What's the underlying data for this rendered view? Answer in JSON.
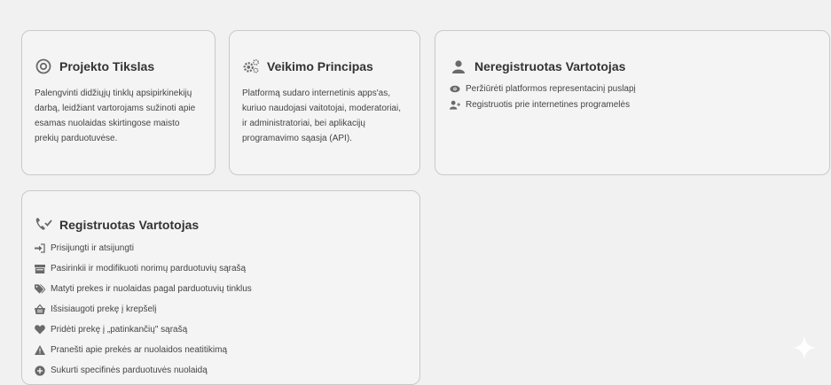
{
  "cards": {
    "projekto": {
      "title": "Projekto Tikslas",
      "icon": "target-icon",
      "text": "Palengvinti didžiųjų tinklų apsipirkinekijų darbą, leidžiant vartorojams sužinoti apie esamas nuolaidas skirtingose maisto prekių parduotuvėse."
    },
    "veikimo": {
      "title": "Veikimo Principas",
      "icon": "gears-icon",
      "text": "Platformą sudaro internetinis apps'as, kuriuo naudojasi vaitotojai, moderatoriai, ir administratoriai, bei aplikacijų programavimo sąasja (API)."
    },
    "neregistruotas": {
      "title": "Neregistruotas Vartotojas",
      "icon": "user-icon",
      "items": [
        {
          "label": "Peržiūrėti platformos representacinį puslapį",
          "icon": "eye-icon"
        },
        {
          "label": "Registruotis prie internetines programelės",
          "icon": "user-plus-icon"
        }
      ]
    },
    "registruotas": {
      "title": "Registruotas Vartotojas",
      "icon": "user-check-icon",
      "items": [
        {
          "label": "Prisijungti ir atsijungti",
          "icon": "sign-in-icon"
        },
        {
          "label": "Pasirinkii ir modifikuoti norimų parduotuvių sąrašą",
          "icon": "store-icon"
        },
        {
          "label": "Matyti prekes ir nuolaidas pagal parduotuvių tinklus",
          "icon": "tags-icon"
        },
        {
          "label": "Išsisiaugoti prekę į krepšelį",
          "icon": "basket-icon"
        },
        {
          "label": "Pridėti prekę į „patinkančių\" sąrašą",
          "icon": "heart-icon"
        },
        {
          "label": "Pranešti apie prekės ar nuolaidos neatitikimą",
          "icon": "warning-icon"
        },
        {
          "label": "Sukurti specifinės parduotuvės nuolaidą",
          "icon": "plus-circle-icon"
        }
      ]
    }
  },
  "colors": {
    "card_bg": "#f4f4f4",
    "border": "#c9c9c9",
    "icon": "#6a6a6a"
  }
}
